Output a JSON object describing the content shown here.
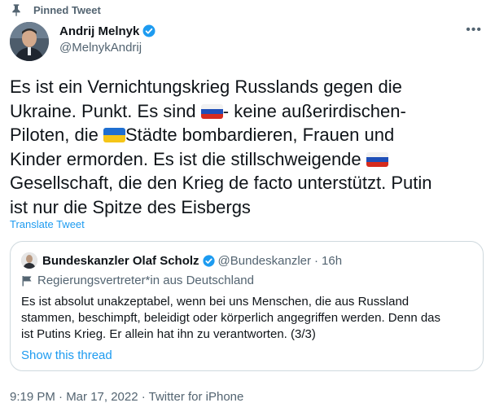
{
  "pinned_label": "Pinned Tweet",
  "author": {
    "name": "Andrij Melnyk",
    "handle": "@MelnykAndrij"
  },
  "tweet": {
    "line1": "Es ist ein Vernichtungskrieg Russlands gegen die",
    "line2a": "Ukraine. Punkt. Es sind ",
    "line2b": "- keine außerirdischen-",
    "line3a": "Piloten, die ",
    "line3b": "Städte bombardieren, Frauen und",
    "line4a": "Kinder ermorden. Es ist die stillschweigende ",
    "line5": "Gesellschaft, die den Krieg de facto unterstützt. Putin",
    "line6": "ist nur die Spitze des Eisbergs"
  },
  "translate_label": "Translate Tweet",
  "quoted": {
    "name": "Bundeskanzler Olaf Scholz",
    "handle": "@Bundeskanzler",
    "separator": "·",
    "time": "16h",
    "label": "Regierungsvertreter*in aus Deutschland",
    "line1": "Es ist absolut unakzeptabel, wenn bei uns Menschen, die aus Russland",
    "line2": "stammen, beschimpft, beleidigt oder körperlich angegriffen werden. Denn das",
    "line3": "ist Putins Krieg. Er allein hat ihn zu verantworten. (3/3)",
    "show_thread": "Show this thread"
  },
  "timestamp": "9:19 PM · Mar 17, 2022 · Twitter for iPhone",
  "colors": {
    "accent": "#1d9bf0",
    "secondary_text": "#536471",
    "border": "#cfd9de"
  },
  "icons": [
    "pin-icon",
    "verified-badge-icon",
    "more-options-icon",
    "russia-flag-emoji",
    "ukraine-flag-emoji",
    "government-flag-icon"
  ]
}
